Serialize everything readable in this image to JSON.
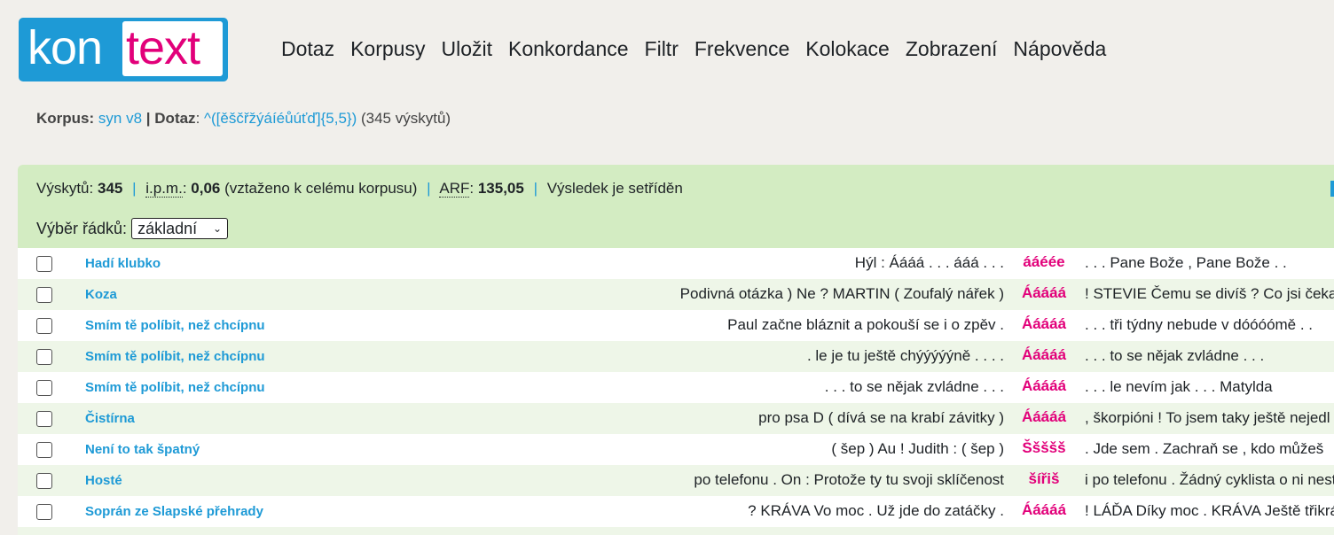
{
  "logo": {
    "part1": "kon",
    "part2": "text"
  },
  "menu": [
    "Dotaz",
    "Korpusy",
    "Uložit",
    "Konkordance",
    "Filtr",
    "Frekvence",
    "Kolokace",
    "Zobrazení",
    "Nápověda"
  ],
  "info": {
    "corpus_label": "Korpus:",
    "corpus_value": "syn v8",
    "separator": "|",
    "query_label": "Dotaz",
    "query_colon": ":",
    "query_value": "^([ěščřžýáíéůúťď]{5,5})",
    "count_text": "(345 výskytů)"
  },
  "stats": {
    "hits_label": "Výskytů:",
    "hits_value": "345",
    "ipm_label": "i.p.m.",
    "ipm_value": "0,06",
    "ipm_note": "(vztaženo k celému korpusu)",
    "arf_label": "ARF",
    "arf_value": "135,05",
    "sorted_text": "Výsledek je setříděn",
    "sep": "|"
  },
  "row_select": {
    "label": "Výběr řádků:",
    "value": "základní"
  },
  "concordance": [
    {
      "doc": "Hadí klubko",
      "left": "Hýl : Áááá . . . ááá . . .",
      "kwic": "ááéée",
      "right": ". . . Pane Bože , Pane Bože . ."
    },
    {
      "doc": "Koza",
      "left": "Podivná otázka ) Ne ? MARTIN ( Zoufalý nářek )",
      "kwic": "Ááááá",
      "right": "! STEVIE Čemu se divíš ? Co jsi čekal"
    },
    {
      "doc": "Smím tě políbit, než chcípnu",
      "left": "Paul začne bláznit a pokouší se i o zpěv .",
      "kwic": "Ááááá",
      "right": ". . . tři týdny nebude v dóóóómě . ."
    },
    {
      "doc": "Smím tě políbit, než chcípnu",
      "left": ". le je tu ještě chýýýýýně . . . .",
      "kwic": "Ááááá",
      "right": ". . . to se nějak zvládne . . ."
    },
    {
      "doc": "Smím tě políbit, než chcípnu",
      "left": ". . . to se nějak zvládne . . .",
      "kwic": "Ááááá",
      "right": ". . . le nevím jak . . . Matylda"
    },
    {
      "doc": "Čistírna",
      "left": "pro psa D ( dívá se na krabí závitky )",
      "kwic": "Ááááá",
      "right": ", škorpióni ! To jsem taky ještě nejedl"
    },
    {
      "doc": "Není to tak špatný",
      "left": "( šep ) Au ! Judith : ( šep )",
      "kwic": "Ššššš",
      "right": ". Jde sem . Zachraň se , kdo můžeš"
    },
    {
      "doc": "Hosté",
      "left": "po telefonu . On : Protože ty tu svoji sklíčenost",
      "kwic": "šířiš",
      "right": "i po telefonu . Žádný cyklista o ni nestojí"
    },
    {
      "doc": "Soprán ze Slapské přehrady",
      "left": "? KRÁVA Vo moc . Už jde do zatáčky .",
      "kwic": "Ááááá",
      "right": "! LÁĎA Díky moc . KRÁVA Ještě třikrát"
    }
  ],
  "colors": {
    "accent": "#1e9ad6",
    "kwic": "#e2007a",
    "panel": "#d3ecc2"
  }
}
